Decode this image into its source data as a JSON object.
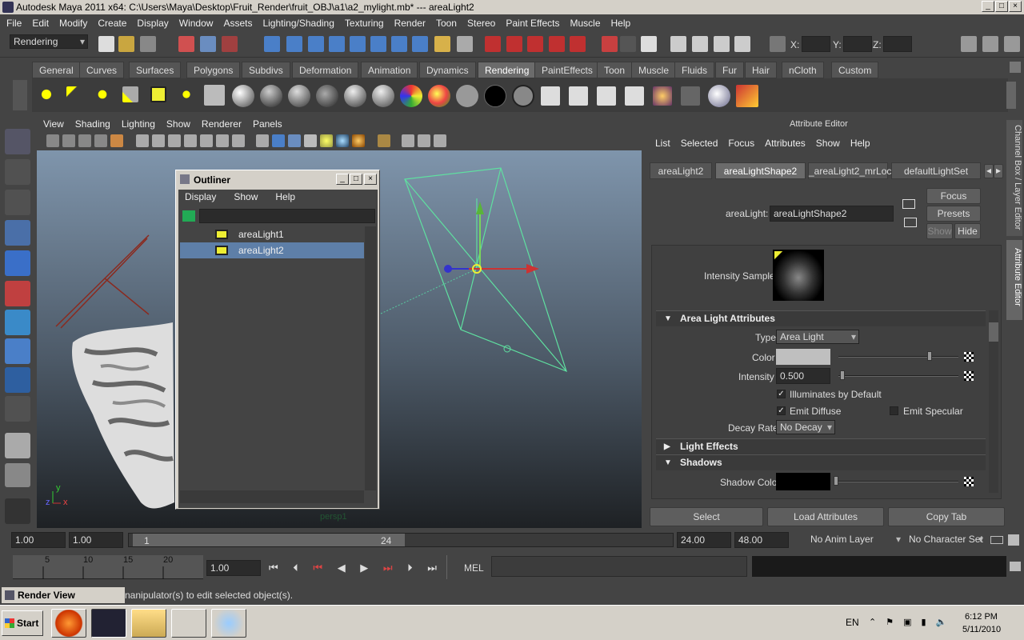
{
  "window": {
    "title": "Autodesk Maya 2011 x64: C:\\Users\\Maya\\Desktop\\Fruit_Render\\fruit_OBJ\\a1\\a2_mylight.mb*   ---   areaLight2"
  },
  "menubar": [
    "File",
    "Edit",
    "Modify",
    "Create",
    "Display",
    "Window",
    "Assets",
    "Lighting/Shading",
    "Texturing",
    "Render",
    "Toon",
    "Stereo",
    "Paint Effects",
    "Muscle",
    "Help"
  ],
  "statusline": {
    "menuset": "Rendering",
    "x_label": "X:",
    "y_label": "Y:",
    "z_label": "Z:"
  },
  "shelf_tabs": [
    "General",
    "Curves",
    "Surfaces",
    "Polygons",
    "Subdivs",
    "Deformation",
    "Animation",
    "Dynamics",
    "Rendering",
    "PaintEffects",
    "Toon",
    "Muscle",
    "Fluids",
    "Fur",
    "Hair",
    "nCloth",
    "Custom"
  ],
  "shelf_active": "Rendering",
  "panel_menu": [
    "View",
    "Shading",
    "Lighting",
    "Show",
    "Renderer",
    "Panels"
  ],
  "viewport": {
    "camera_label": "persp1",
    "axis_y": "y",
    "axis_z": "z",
    "axis_x": "x"
  },
  "outliner": {
    "title": "Outliner",
    "menu": [
      "Display",
      "Show",
      "Help"
    ],
    "items": [
      {
        "label": "areaLight1",
        "selected": false
      },
      {
        "label": "areaLight2",
        "selected": true
      }
    ]
  },
  "attribute_editor": {
    "title": "Attribute Editor",
    "menu": [
      "List",
      "Selected",
      "Focus",
      "Attributes",
      "Show",
      "Help"
    ],
    "tabs": [
      "areaLight2",
      "areaLightShape2",
      "_areaLight2_mrLoc",
      "defaultLightSet"
    ],
    "active_tab": "areaLightShape2",
    "node_label": "areaLight:",
    "node_value": "areaLightShape2",
    "buttons": {
      "focus": "Focus",
      "presets": "Presets",
      "show": "Show",
      "hide": "Hide"
    },
    "intensity_sample_label": "Intensity Sample",
    "sections": {
      "area_light": "Area Light Attributes",
      "light_effects": "Light Effects",
      "shadows": "Shadows"
    },
    "fields": {
      "type_label": "Type",
      "type_value": "Area Light",
      "color_label": "Color",
      "color_slider": 0.75,
      "intensity_label": "Intensity",
      "intensity_value": "0.500",
      "illuminates_label": "Illuminates by Default",
      "illuminates_checked": true,
      "emit_diffuse_label": "Emit Diffuse",
      "emit_diffuse_checked": true,
      "emit_specular_label": "Emit Specular",
      "emit_specular_checked": false,
      "decay_label": "Decay Rate",
      "decay_value": "No Decay",
      "shadow_color_label": "Shadow Color"
    },
    "bottom_buttons": {
      "select": "Select",
      "load": "Load Attributes",
      "copy": "Copy Tab"
    }
  },
  "side_tabs": {
    "channel_box": "Channel Box / Layer Editor",
    "attribute_editor": "Attribute Editor"
  },
  "timeline": {
    "start": "1.00",
    "playback_start": "1.00",
    "range_start": "1",
    "range_end": "24",
    "end": "24.00",
    "anim_end": "48.00",
    "anim_layer": "No Anim Layer",
    "char_set": "No Character Set",
    "ticks": [
      "5",
      "10",
      "15",
      "20"
    ],
    "current_time": "1.00",
    "mel_label": "MEL"
  },
  "help_line": "nanipulator(s) to edit selected object(s).",
  "render_view_tab": "Render View",
  "taskbar": {
    "start": "Start",
    "lang": "EN",
    "time": "6:12 PM",
    "date": "5/11/2010"
  }
}
